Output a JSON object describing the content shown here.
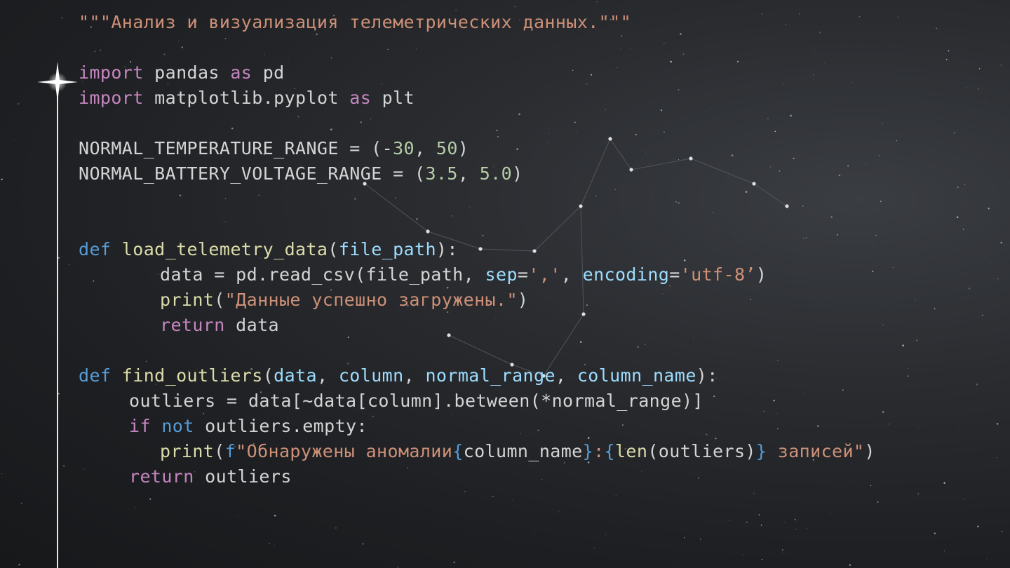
{
  "code": {
    "docstring": "\"\"\"Анализ и визуализация телеметрических данных.\"\"\"",
    "l_import1": {
      "kw": "import",
      "mod": " pandas ",
      "as": "as",
      "alias": " pd"
    },
    "l_import2": {
      "kw": "import",
      "mod": " matplotlib.pyplot ",
      "as": "as",
      "alias": " plt"
    },
    "l_temp": {
      "name": "NORMAL_TEMPERATURE_RANGE = (-",
      "n1": "30",
      ",": ", ",
      "n2": "50",
      ")": ")"
    },
    "l_volt": {
      "name": "NORMAL_BATTERY_VOLTAGE_RANGE = (",
      "n1": "3.5",
      ",": ", ",
      "n2": "5.0",
      ")": ")"
    },
    "l_def1": {
      "def": "def",
      "name": " load_telemetry_data",
      "open": "(",
      "param": "file_path",
      "close": "):"
    },
    "l_read": {
      "a": "data = pd.read_csv(file_path, ",
      "sep": "sep",
      "eq": "=",
      "sepv": "','",
      ",": ", ",
      "enc": "encoding",
      "eq2": "=",
      "encv": "'utf-8’",
      "close": ")"
    },
    "l_print1": {
      "fn": "print",
      "open": "(",
      "str": "\"Данные успешно загружены.\"",
      "close": ")"
    },
    "l_ret1": {
      "kw": "return",
      "rest": " data"
    },
    "l_def2": {
      "def": "def",
      "name": " find_outliers",
      "open": "(",
      "p1": "data",
      ",1": ", ",
      "p2": "column",
      ",2": ", ",
      "p3": "normal_range",
      ",3": ", ",
      "p4": "column_name",
      "close": "):"
    },
    "l_out": {
      "text": "outliers = data[~data[column].between(*normal_range)]"
    },
    "l_if": {
      "if": "if",
      "not": " not",
      "rest": " outliers.empty:"
    },
    "l_print2": {
      "fn": "print",
      "open": "(",
      "f": "f",
      "s1": "\"Обнаружены аномалии",
      "b1": "{",
      "e1": "column_name",
      "b2": "}",
      ":": ":",
      "b3": "{",
      "len": "len",
      "e2": "(outliers)",
      "b4": "}",
      "s2": " записей\"",
      "close": ")"
    },
    "l_ret2": {
      "kw": "return",
      "rest": " outliers"
    }
  },
  "colors": {
    "string": "#ce9178",
    "keyword": "#c586c0",
    "def": "#569cd6",
    "function": "#dcdcaa",
    "variable": "#9cdcfe",
    "number": "#b5cea8",
    "plain": "#d4d4d4"
  }
}
